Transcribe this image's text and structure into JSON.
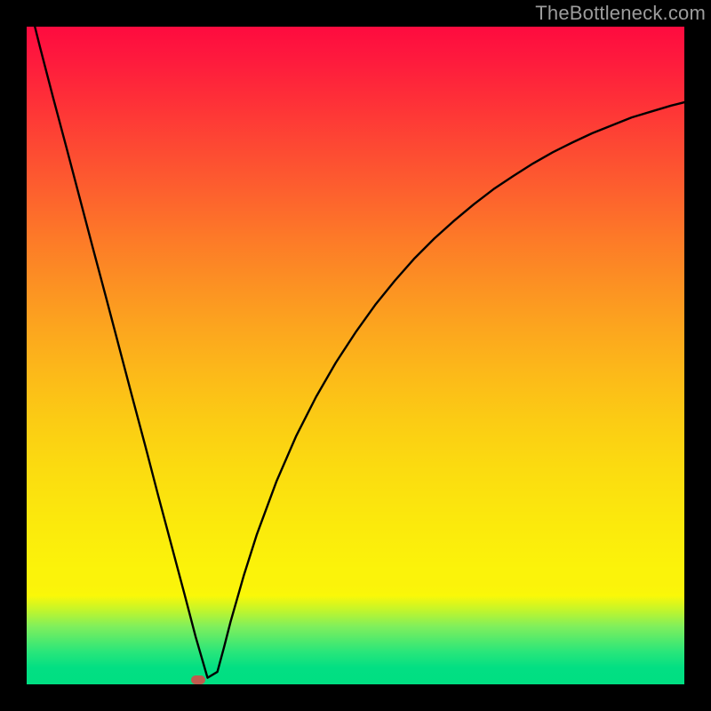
{
  "watermark": {
    "text": "TheBottleneck.com"
  },
  "chart_data": {
    "type": "line",
    "title": "",
    "xlabel": "",
    "ylabel": "",
    "xlim": [
      0,
      100
    ],
    "ylim": [
      0,
      100
    ],
    "grid": false,
    "legend": false,
    "series": [
      {
        "name": "bottleneck-curve",
        "x": [
          0.5,
          2,
          4,
          6,
          8,
          10,
          12,
          14,
          16,
          18,
          20,
          22,
          24,
          25.7,
          27.5,
          29,
          30,
          31,
          33,
          35,
          38,
          41,
          44,
          47,
          50,
          53,
          56,
          59,
          62,
          65,
          68,
          71,
          74,
          77,
          80,
          83,
          86,
          89,
          92,
          95,
          98,
          100
        ],
        "y": [
          103,
          97,
          89.3,
          81.8,
          74.2,
          66.6,
          59.1,
          51.5,
          43.9,
          36.4,
          28.7,
          21.2,
          13.7,
          7.2,
          1.0,
          1.9,
          5.6,
          9.5,
          16.5,
          22.8,
          30.9,
          37.8,
          43.7,
          48.9,
          53.5,
          57.7,
          61.4,
          64.8,
          67.8,
          70.5,
          73.0,
          75.3,
          77.3,
          79.2,
          80.9,
          82.4,
          83.8,
          85.0,
          86.2,
          87.1,
          88.0,
          88.5
        ]
      }
    ],
    "marker": {
      "x": 26.1,
      "y": 0.7,
      "color": "#bf5b4e"
    },
    "background_gradient": {
      "stops": [
        {
          "pos": 0,
          "color": "#fe0b3f"
        },
        {
          "pos": 0.25,
          "color": "#fd602e"
        },
        {
          "pos": 0.5,
          "color": "#fcb01b"
        },
        {
          "pos": 0.75,
          "color": "#fbe70d"
        },
        {
          "pos": 0.87,
          "color": "#f9f808"
        },
        {
          "pos": 1.0,
          "color": "#00df82"
        }
      ]
    }
  }
}
